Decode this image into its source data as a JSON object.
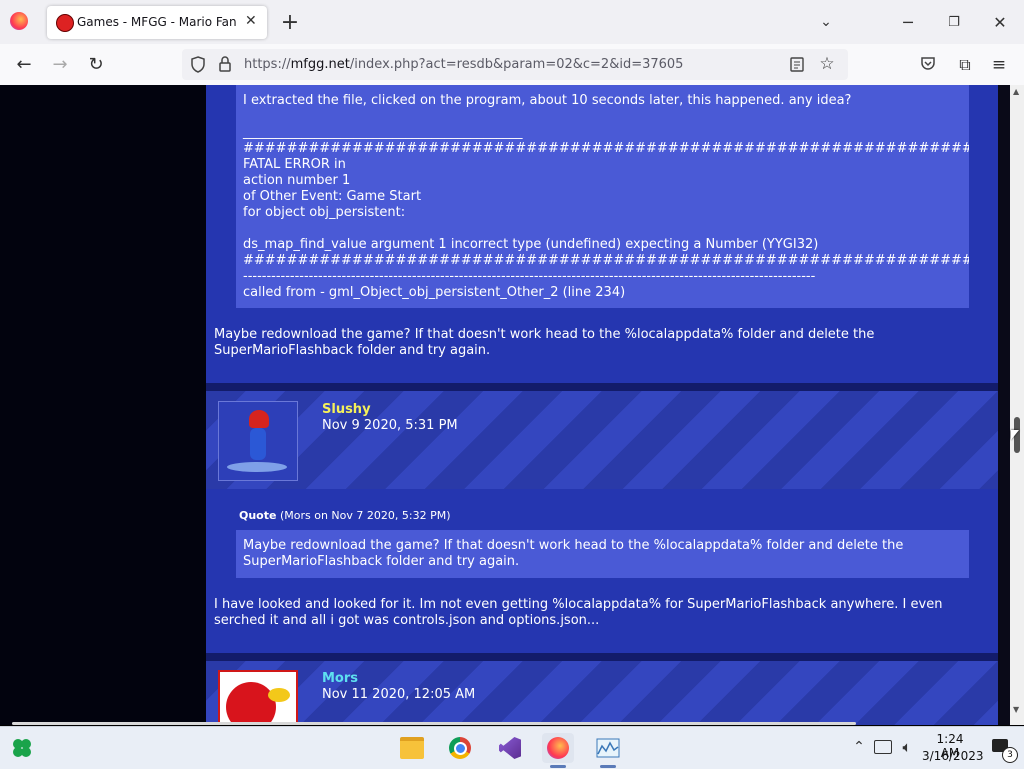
{
  "browser": {
    "tab_title": "Games - MFGG - Mario Fan Games Galaxy",
    "new_tab": "+",
    "url_prefix": "https://",
    "url_host": "mfgg.net",
    "url_path": "/index.php?act=resdb&param=02&c=2&id=37605"
  },
  "post1": {
    "question": "I extracted the file, clicked on the program, about 10 seconds later, this happened. any idea?",
    "underline": "___________________________________________",
    "error_lines": [
      "##########################################################################################",
      "FATAL ERROR in",
      "action number 1",
      "of Other Event: Game Start",
      "for object obj_persistent:",
      "",
      "ds_map_find_value argument 1 incorrect type (undefined) expecting a Number (YYGI32)",
      "##########################################################################################",
      "--------------------------------------------------------------------------------------------------------------------------",
      "called from - gml_Object_obj_persistent_Other_2 (line 234)"
    ],
    "reply": "Maybe redownload the game? If that doesn't work head to the %localappdata% folder and delete the SuperMarioFlashback folder and try again."
  },
  "post2": {
    "username": "Slushy",
    "date": "Nov 9 2020, 5:31 PM",
    "quote_label": "Quote",
    "quote_meta": "(Mors on Nov 7 2020, 5:32 PM)",
    "quote_text": "Maybe redownload the game? If that doesn't work head to the %localappdata% folder and delete the SuperMarioFlashback folder and try again.",
    "body": "I have looked and looked for it. Im not even getting %localappdata% for SuperMarioFlashback anywhere. I even serched it and all i got was controls.json and options.json..."
  },
  "post3": {
    "username": "Mors",
    "date": "Nov 11 2020, 12:05 AM"
  },
  "taskbar": {
    "time": "1:24 AM",
    "date": "3/16/2023",
    "notif_count": "3"
  },
  "colors": {
    "post_bg": "#2536b0",
    "quote_bg": "#4a5ad6",
    "slushy_name": "#f4f05a",
    "mors_name": "#5ee0f0"
  }
}
